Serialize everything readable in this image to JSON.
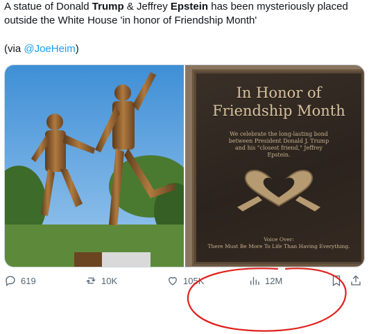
{
  "tweet": {
    "text_part1": "A statue of Donald ",
    "text_bold1": "Trump",
    "text_part2": " & Jeffrey ",
    "text_bold2": "Epstein",
    "text_part3": " has been mysteriously placed outside the White House 'in honor of Friendship Month'",
    "via_prefix": "(via ",
    "via_handle": "@JoeHeim",
    "via_suffix": ")"
  },
  "plaque": {
    "title_line1": "In Honor of",
    "title_line2": "Friendship Month",
    "body": "We celebrate the long-lasting bond between President Donald J. Trump and his \"closest friend,\" Jeffrey Epstein.",
    "footer_line1": "Voice Over:",
    "footer_line2": "There Must Be More To Life Than Having Everything."
  },
  "actions": {
    "replies": "619",
    "reposts": "10K",
    "likes": "105K",
    "views": "12M"
  },
  "icons": [
    "reply-icon",
    "repost-icon",
    "like-icon",
    "views-icon",
    "bookmark-icon",
    "share-icon"
  ],
  "colors": {
    "link": "#1d9bf0",
    "icon": "#536471",
    "annotation": "#e0201b"
  }
}
